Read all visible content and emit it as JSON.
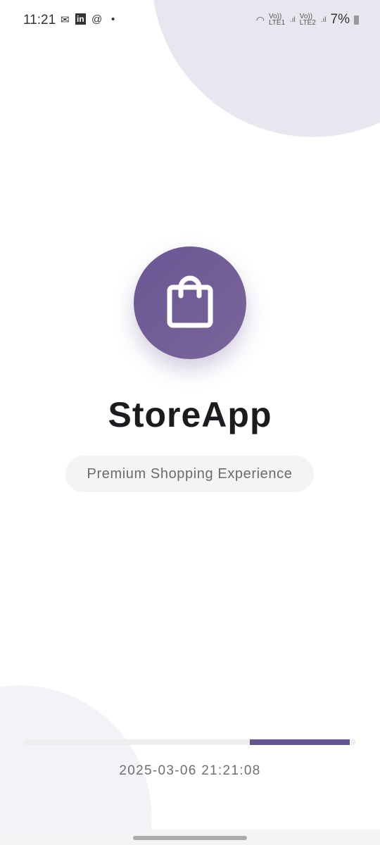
{
  "status_bar": {
    "time": "11:21",
    "notification_icons": [
      "messenger-icon",
      "linkedin-icon",
      "threads-icon",
      "dot-icon"
    ],
    "sim1": "Vo)) LTE1",
    "sim2": "Vo)) LTE2",
    "battery": "7%"
  },
  "app": {
    "title": "StoreApp",
    "tagline": "Premium Shopping Experience",
    "timestamp": "2025-03-06 21:21:08",
    "icon": "shopping-bag-icon"
  },
  "loading": {
    "segment_start": 0.68,
    "segment_end": 0.98
  },
  "colors": {
    "accent": "#65558f",
    "logo_bg": "#6a5694"
  }
}
